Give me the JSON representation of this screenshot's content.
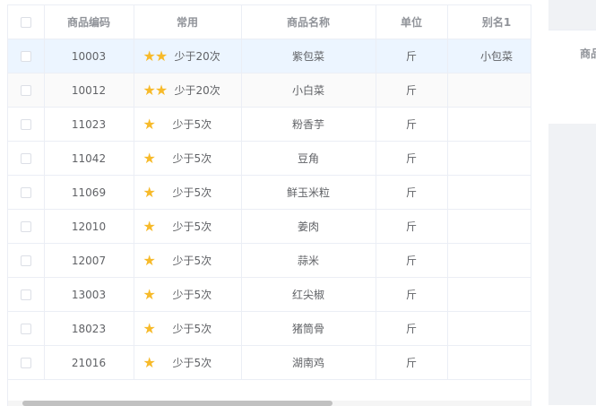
{
  "table": {
    "columns": [
      "商品编码",
      "常用",
      "商品名称",
      "单位",
      "别名1"
    ],
    "rows": [
      {
        "code": "10003",
        "stars": "★★",
        "freq": "少于20次",
        "name": "紫包菜",
        "unit": "斤",
        "alias": "小包菜"
      },
      {
        "code": "10012",
        "stars": "★★",
        "freq": "少于20次",
        "name": "小白菜",
        "unit": "斤",
        "alias": ""
      },
      {
        "code": "11023",
        "stars": "★",
        "freq": "少于5次",
        "name": "粉香芋",
        "unit": "斤",
        "alias": ""
      },
      {
        "code": "11042",
        "stars": "★",
        "freq": "少于5次",
        "name": "豆角",
        "unit": "斤",
        "alias": ""
      },
      {
        "code": "11069",
        "stars": "★",
        "freq": "少于5次",
        "name": "鲜玉米粒",
        "unit": "斤",
        "alias": ""
      },
      {
        "code": "12010",
        "stars": "★",
        "freq": "少于5次",
        "name": "姜肉",
        "unit": "斤",
        "alias": ""
      },
      {
        "code": "12007",
        "stars": "★",
        "freq": "少于5次",
        "name": "蒜米",
        "unit": "斤",
        "alias": ""
      },
      {
        "code": "13003",
        "stars": "★",
        "freq": "少于5次",
        "name": "红尖椒",
        "unit": "斤",
        "alias": ""
      },
      {
        "code": "18023",
        "stars": "★",
        "freq": "少于5次",
        "name": "猪筒骨",
        "unit": "斤",
        "alias": ""
      },
      {
        "code": "21016",
        "stars": "★",
        "freq": "少于5次",
        "name": "湖南鸡",
        "unit": "斤",
        "alias": ""
      }
    ]
  },
  "right_panel": {
    "header_text": "商品"
  },
  "colors": {
    "star": "#f7ba2a",
    "selected_row": "#ecf5ff",
    "border": "#ebeef5",
    "header_text": "#909399"
  },
  "icons": {
    "star": "star-icon",
    "checkbox": "checkbox"
  }
}
